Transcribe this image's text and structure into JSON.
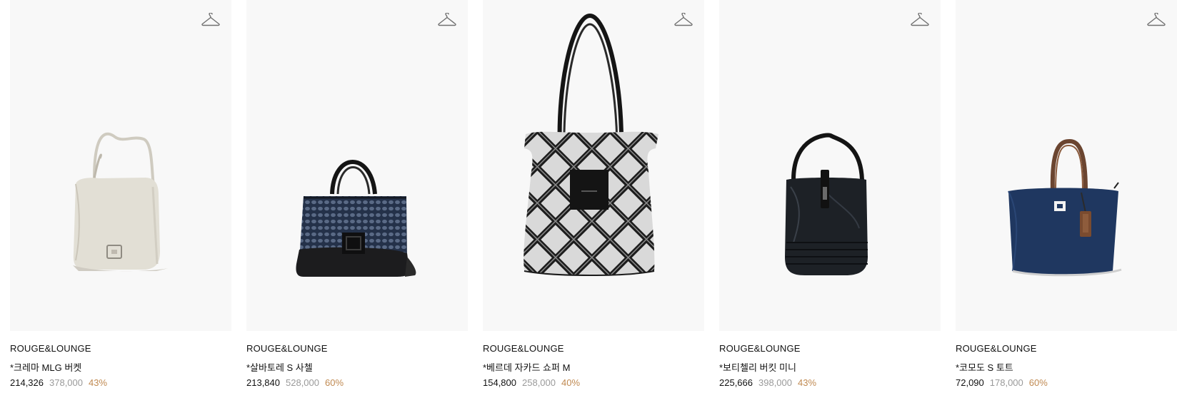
{
  "products": [
    {
      "brand": "ROUGE&LOUNGE",
      "name": "*크레마 MLG 버켓",
      "price": "214,326",
      "original_price": "378,000",
      "discount": "43%",
      "icon": "hanger-icon"
    },
    {
      "brand": "ROUGE&LOUNGE",
      "name": "*살바토레 S 사첼",
      "price": "213,840",
      "original_price": "528,000",
      "discount": "60%",
      "icon": "hanger-icon"
    },
    {
      "brand": "ROUGE&LOUNGE",
      "name": "*베르데 자카드 쇼퍼 M",
      "price": "154,800",
      "original_price": "258,000",
      "discount": "40%",
      "icon": "hanger-icon"
    },
    {
      "brand": "ROUGE&LOUNGE",
      "name": "*보티첼리 버킷 미니",
      "price": "225,666",
      "original_price": "398,000",
      "discount": "43%",
      "icon": "hanger-icon"
    },
    {
      "brand": "ROUGE&LOUNGE",
      "name": "*코모도 S 토트",
      "price": "72,090",
      "original_price": "178,000",
      "discount": "60%",
      "icon": "hanger-icon"
    }
  ],
  "colors": {
    "image_bg": "#f8f8f8",
    "original_price": "#9a9a9a",
    "discount": "#c08a52"
  }
}
